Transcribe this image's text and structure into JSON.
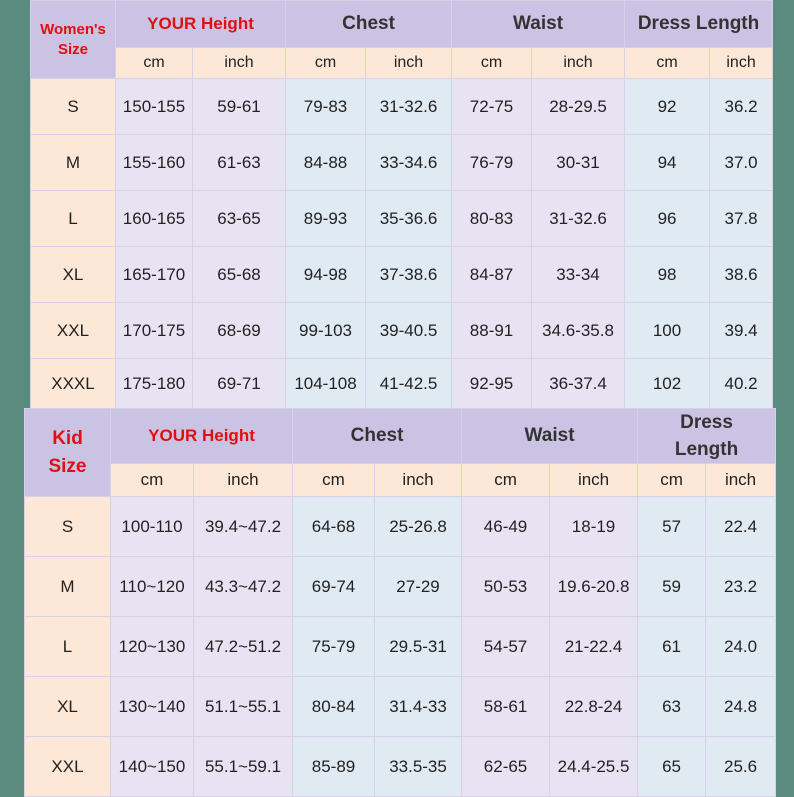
{
  "women": {
    "corner": [
      "Women's",
      "Size"
    ],
    "groups": [
      "YOUR Height",
      "Chest",
      "Waist",
      "Dress Length"
    ],
    "units": [
      "cm",
      "inch",
      "cm",
      "inch",
      "cm",
      "inch",
      "cm",
      "inch"
    ],
    "rows": [
      [
        "S",
        "150-155",
        "59-61",
        "79-83",
        "31-32.6",
        "72-75",
        "28-29.5",
        "92",
        "36.2"
      ],
      [
        "M",
        "155-160",
        "61-63",
        "84-88",
        "33-34.6",
        "76-79",
        "30-31",
        "94",
        "37.0"
      ],
      [
        "L",
        "160-165",
        "63-65",
        "89-93",
        "35-36.6",
        "80-83",
        "31-32.6",
        "96",
        "37.8"
      ],
      [
        "XL",
        "165-170",
        "65-68",
        "94-98",
        "37-38.6",
        "84-87",
        "33-34",
        "98",
        "38.6"
      ],
      [
        "XXL",
        "170-175",
        "68-69",
        "99-103",
        "39-40.5",
        "88-91",
        "34.6-35.8",
        "100",
        "39.4"
      ],
      [
        "XXXL",
        "175-180",
        "69-71",
        "104-108",
        "41-42.5",
        "92-95",
        "36-37.4",
        "102",
        "40.2"
      ]
    ]
  },
  "kid": {
    "corner": [
      "Kid",
      "Size"
    ],
    "groups": [
      "YOUR Height",
      "Chest",
      "Waist",
      "Dress",
      "Length"
    ],
    "units": [
      "cm",
      "inch",
      "cm",
      "inch",
      "cm",
      "inch",
      "cm",
      "inch"
    ],
    "rows": [
      [
        "S",
        "100-110",
        "39.4~47.2",
        "64-68",
        "25-26.8",
        "46-49",
        "18-19",
        "57",
        "22.4"
      ],
      [
        "M",
        "110~120",
        "43.3~47.2",
        "69-74",
        "27-29",
        "50-53",
        "19.6-20.8",
        "59",
        "23.2"
      ],
      [
        "L",
        "120~130",
        "47.2~51.2",
        "75-79",
        "29.5-31",
        "54-57",
        "21-22.4",
        "61",
        "24.0"
      ],
      [
        "XL",
        "130~140",
        "51.1~55.1",
        "80-84",
        "31.4-33",
        "58-61",
        "22.8-24",
        "63",
        "24.8"
      ],
      [
        "XXL",
        "140~150",
        "55.1~59.1",
        "85-89",
        "33.5-35",
        "62-65",
        "24.4-25.5",
        "65",
        "25.6"
      ]
    ]
  },
  "colors": {
    "background": "#5b8a7e",
    "header_bg": "#cbc3e3",
    "unit_bg": "#fde7d6",
    "accent_red": "#e01010"
  }
}
